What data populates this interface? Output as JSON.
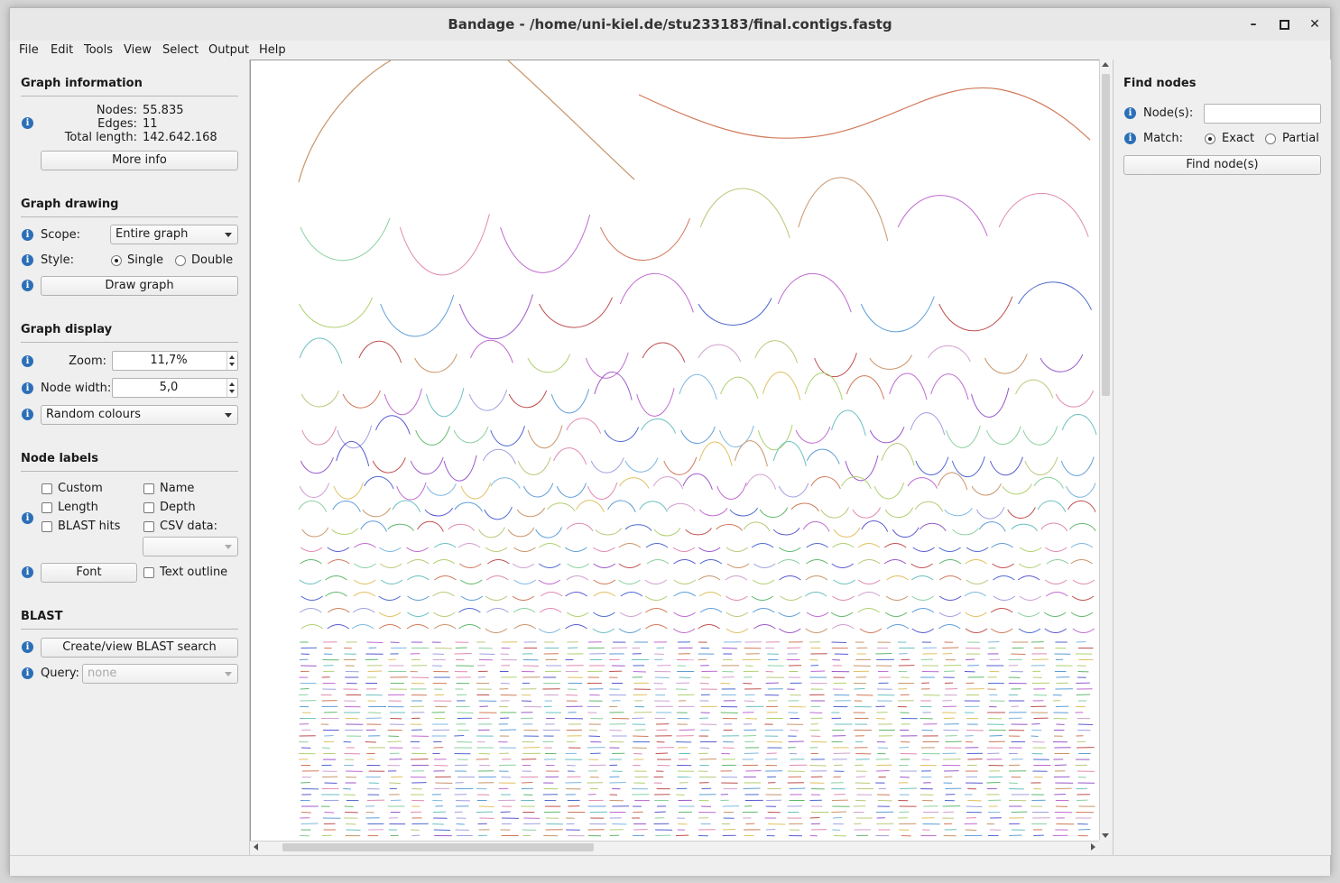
{
  "window": {
    "title": "Bandage - /home/uni-kiel.de/stu233183/final.contigs.fastg",
    "minimize": "–",
    "maximize": "▫",
    "close": "✕"
  },
  "menu": [
    "File",
    "Edit",
    "Tools",
    "View",
    "Select",
    "Output",
    "Help"
  ],
  "graph_information": {
    "title": "Graph information",
    "nodes_label": "Nodes:",
    "nodes_value": "55.835",
    "edges_label": "Edges:",
    "edges_value": "11",
    "length_label": "Total length:",
    "length_value": "142.642.168",
    "more_info": "More info"
  },
  "graph_drawing": {
    "title": "Graph drawing",
    "scope_label": "Scope:",
    "scope_value": "Entire graph",
    "style_label": "Style:",
    "style_single": "Single",
    "style_double": "Double",
    "style_selected": "Single",
    "draw_button": "Draw graph"
  },
  "graph_display": {
    "title": "Graph display",
    "zoom_label": "Zoom:",
    "zoom_value": "11,7%",
    "node_width_label": "Node width:",
    "node_width_value": "5,0",
    "colour_scheme": "Random colours"
  },
  "node_labels": {
    "title": "Node labels",
    "custom": "Custom",
    "name": "Name",
    "length": "Length",
    "depth": "Depth",
    "blast_hits": "BLAST hits",
    "csv_data": "CSV data:",
    "font_button": "Font",
    "text_outline": "Text outline"
  },
  "blast": {
    "title": "BLAST",
    "create_button": "Create/view BLAST search",
    "query_label": "Query:",
    "query_value": "none"
  },
  "find_nodes": {
    "title": "Find nodes",
    "nodes_label": "Node(s):",
    "nodes_value": "",
    "match_label": "Match:",
    "exact": "Exact",
    "partial": "Partial",
    "match_selected": "Exact",
    "find_button": "Find node(s)"
  },
  "graph_palette": [
    "#c8956a",
    "#d17a5a",
    "#b9c97a",
    "#62b86e",
    "#4f6ad0",
    "#5f9ed6",
    "#9b59c9",
    "#c06ad1",
    "#7fb8e0",
    "#e08ab0",
    "#8ad0a0",
    "#a0a0e0",
    "#e0c060",
    "#6ac0c0",
    "#d0a0d0",
    "#c05050",
    "#5a5ad0",
    "#b0d070"
  ]
}
